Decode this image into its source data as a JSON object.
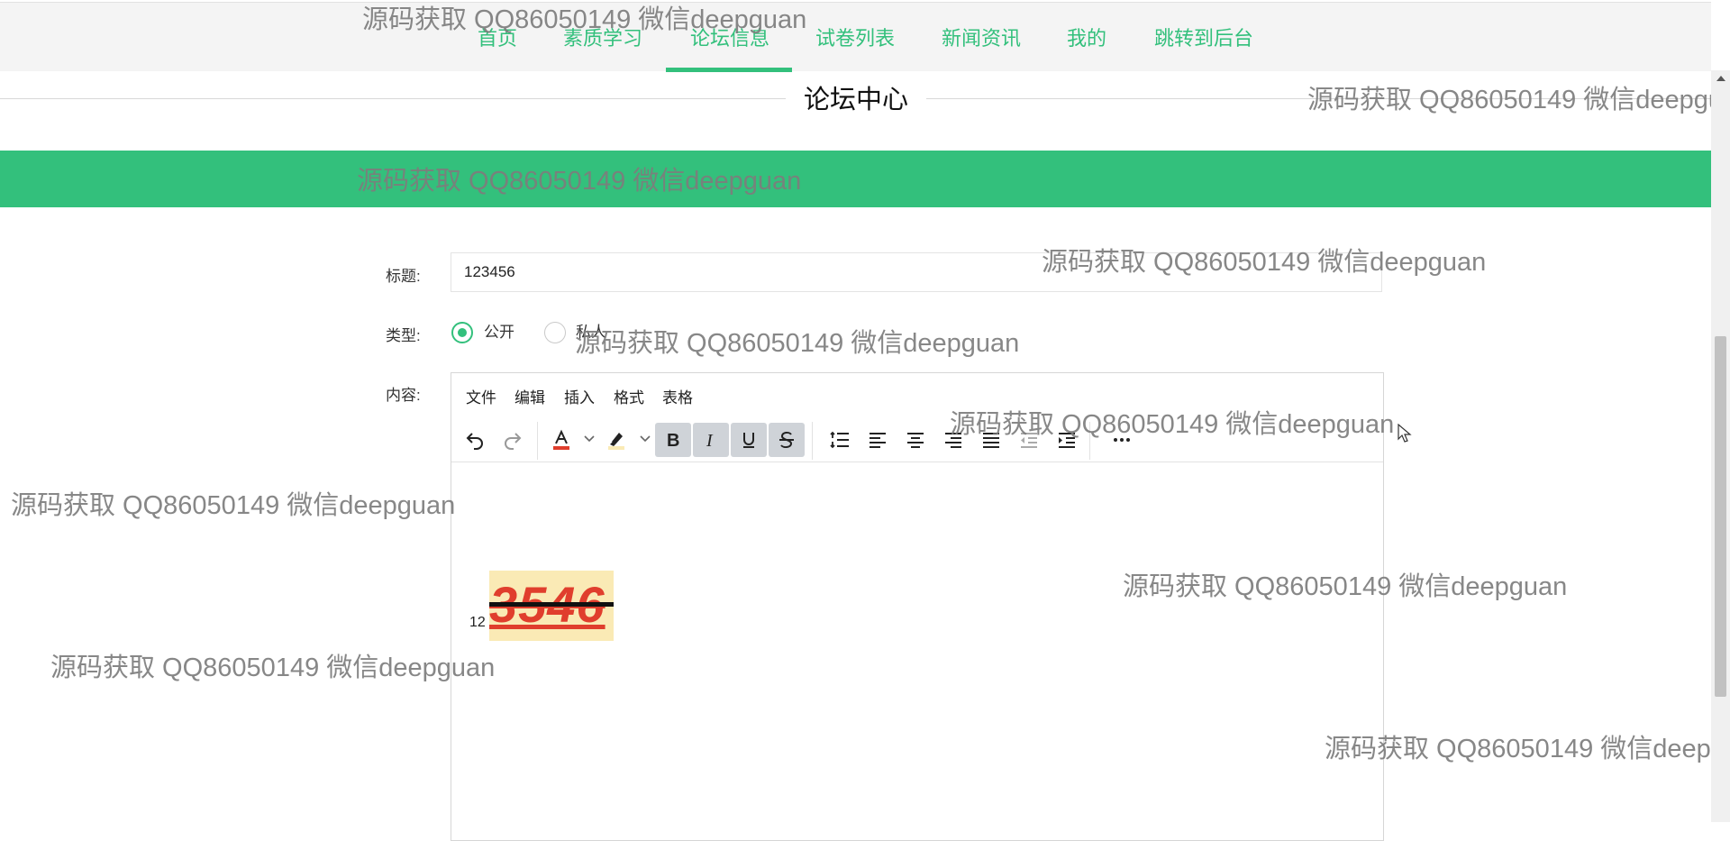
{
  "nav": {
    "items": [
      {
        "label": "首页"
      },
      {
        "label": "素质学习"
      },
      {
        "label": "论坛信息"
      },
      {
        "label": "试卷列表"
      },
      {
        "label": "新闻资讯"
      },
      {
        "label": "我的"
      },
      {
        "label": "跳转到后台"
      }
    ],
    "active_index": 2
  },
  "page": {
    "section_title": "论坛中心"
  },
  "form": {
    "title_label": "标题:",
    "title_value": "123456",
    "type_label": "类型:",
    "type_options": [
      {
        "label": "公开",
        "checked": true
      },
      {
        "label": "私人",
        "checked": false
      }
    ],
    "content_label": "内容:"
  },
  "editor": {
    "menu": [
      "文件",
      "编辑",
      "插入",
      "格式",
      "表格"
    ],
    "toolbar_icons": [
      "undo-icon",
      "redo-icon",
      "text-color-icon",
      "highlight-color-icon",
      "bold-icon",
      "italic-icon",
      "underline-icon",
      "strikethrough-icon",
      "line-height-icon",
      "align-left-icon",
      "align-center-icon",
      "align-right-icon",
      "align-justify-icon",
      "outdent-icon",
      "indent-icon",
      "more-icon"
    ],
    "active_formats": [
      "bold",
      "italic",
      "underline",
      "strikethrough"
    ],
    "content": {
      "small_text": "12",
      "big_text": "3546"
    }
  },
  "watermark": {
    "text": "源码获取 QQ86050149 微信deepguan"
  },
  "colors": {
    "accent": "#33c07c",
    "text_color": "#e03e2d",
    "highlight": "#faeab5"
  }
}
